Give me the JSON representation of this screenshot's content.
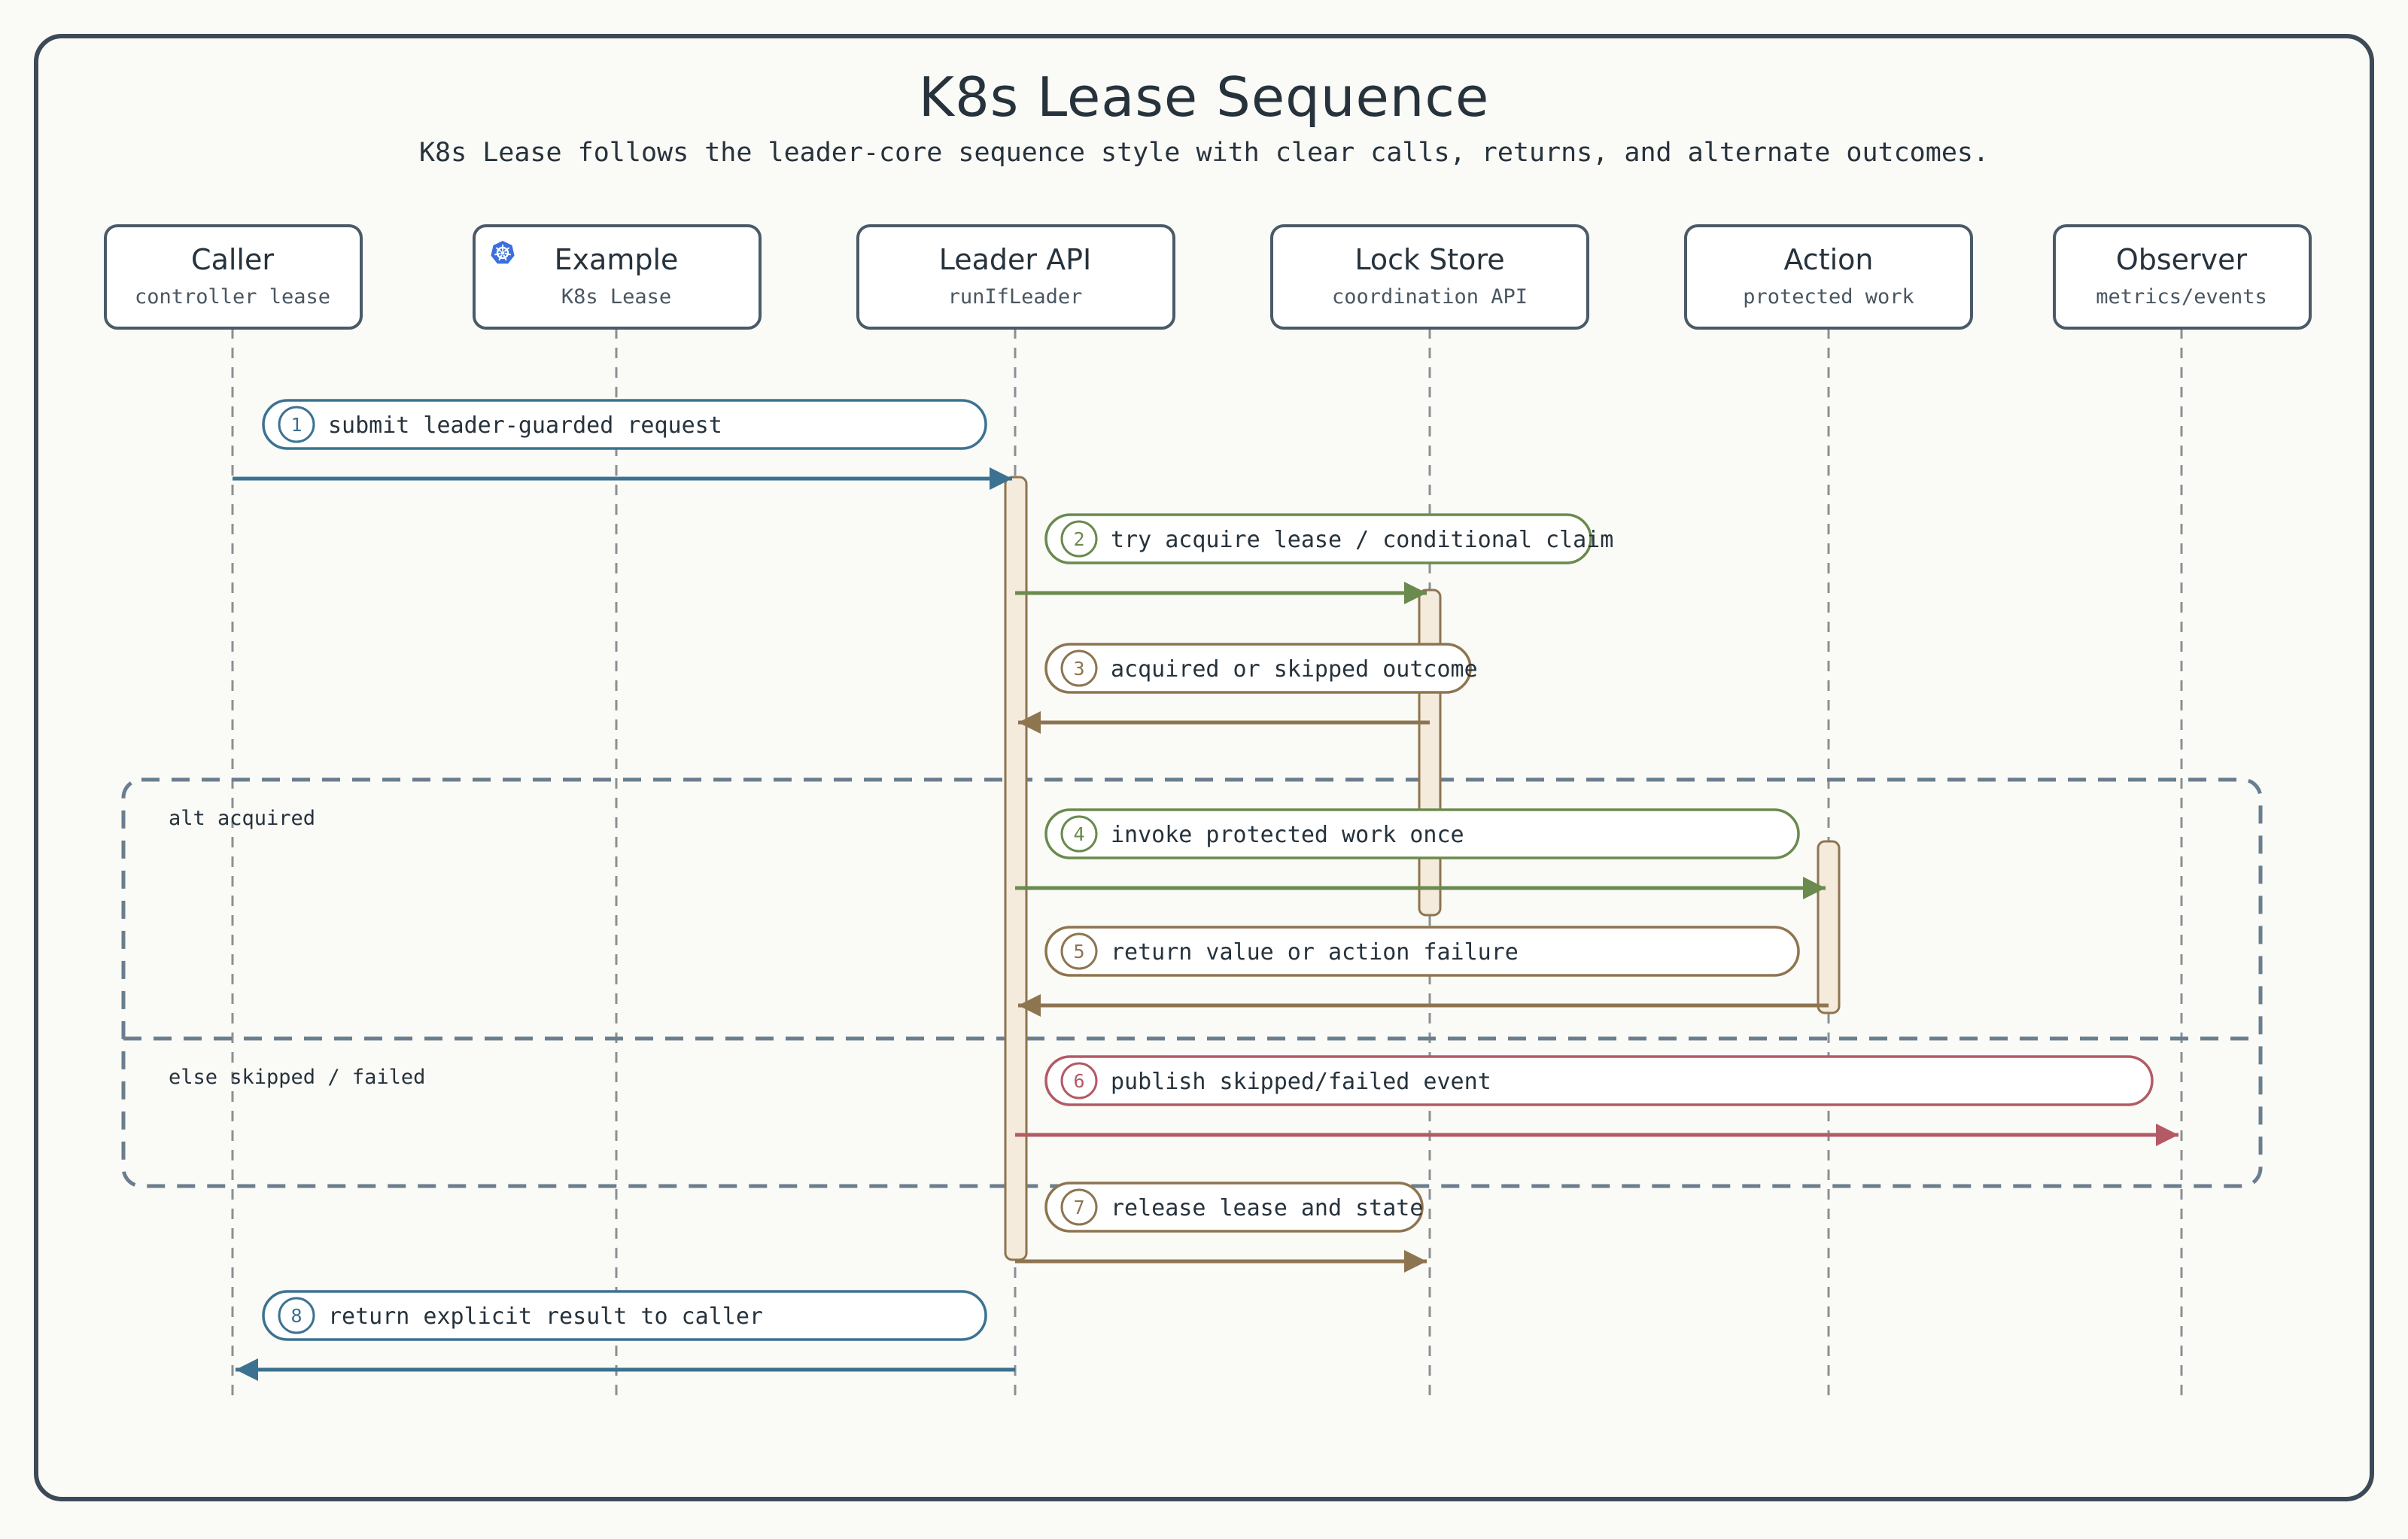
{
  "title": "K8s Lease Sequence",
  "subtitle": "K8s Lease follows the leader-core sequence style with clear calls, returns, and alternate outcomes.",
  "colors": {
    "background": "#fafaf6",
    "frame": "#3c4a58",
    "text": "#26323c",
    "lifeline": "#8a9096",
    "participant_border": "#4a5a68",
    "activation_fill": "#f4ebdc",
    "activation_border": "#8d7550",
    "fragment": "#6a7e8e",
    "blue": "#3c7291",
    "green": "#6a8a4e",
    "brown": "#8d7550",
    "red": "#b35a65",
    "k8s_icon": "#3a6fe0"
  },
  "participants": [
    {
      "id": "caller",
      "name": "Caller",
      "sub": "controller lease",
      "icon": ""
    },
    {
      "id": "example",
      "name": "Example",
      "sub": "K8s Lease",
      "icon": "kubernetes-icon"
    },
    {
      "id": "leader",
      "name": "Leader API",
      "sub": "runIfLeader",
      "icon": ""
    },
    {
      "id": "lock",
      "name": "Lock Store",
      "sub": "coordination API",
      "icon": ""
    },
    {
      "id": "action",
      "name": "Action",
      "sub": "protected work",
      "icon": ""
    },
    {
      "id": "observer",
      "name": "Observer",
      "sub": "metrics/events",
      "icon": ""
    }
  ],
  "messages": [
    {
      "n": "1",
      "text": "submit leader-guarded request",
      "from": "caller",
      "to": "leader",
      "color": "blue"
    },
    {
      "n": "2",
      "text": "try acquire lease / conditional claim",
      "from": "leader",
      "to": "lock",
      "color": "green"
    },
    {
      "n": "3",
      "text": "acquired or skipped outcome",
      "from": "lock",
      "to": "leader",
      "color": "brown"
    },
    {
      "n": "4",
      "text": "invoke protected work once",
      "from": "leader",
      "to": "action",
      "color": "green"
    },
    {
      "n": "5",
      "text": "return value or action failure",
      "from": "action",
      "to": "leader",
      "color": "brown"
    },
    {
      "n": "6",
      "text": "publish skipped/failed event",
      "from": "leader",
      "to": "observer",
      "color": "red"
    },
    {
      "n": "7",
      "text": "release lease and state",
      "from": "leader",
      "to": "lock",
      "color": "brown"
    },
    {
      "n": "8",
      "text": "return explicit result to caller",
      "from": "leader",
      "to": "caller",
      "color": "blue"
    }
  ],
  "fragment": {
    "alt_label": "alt acquired",
    "else_label": "else skipped / failed"
  }
}
